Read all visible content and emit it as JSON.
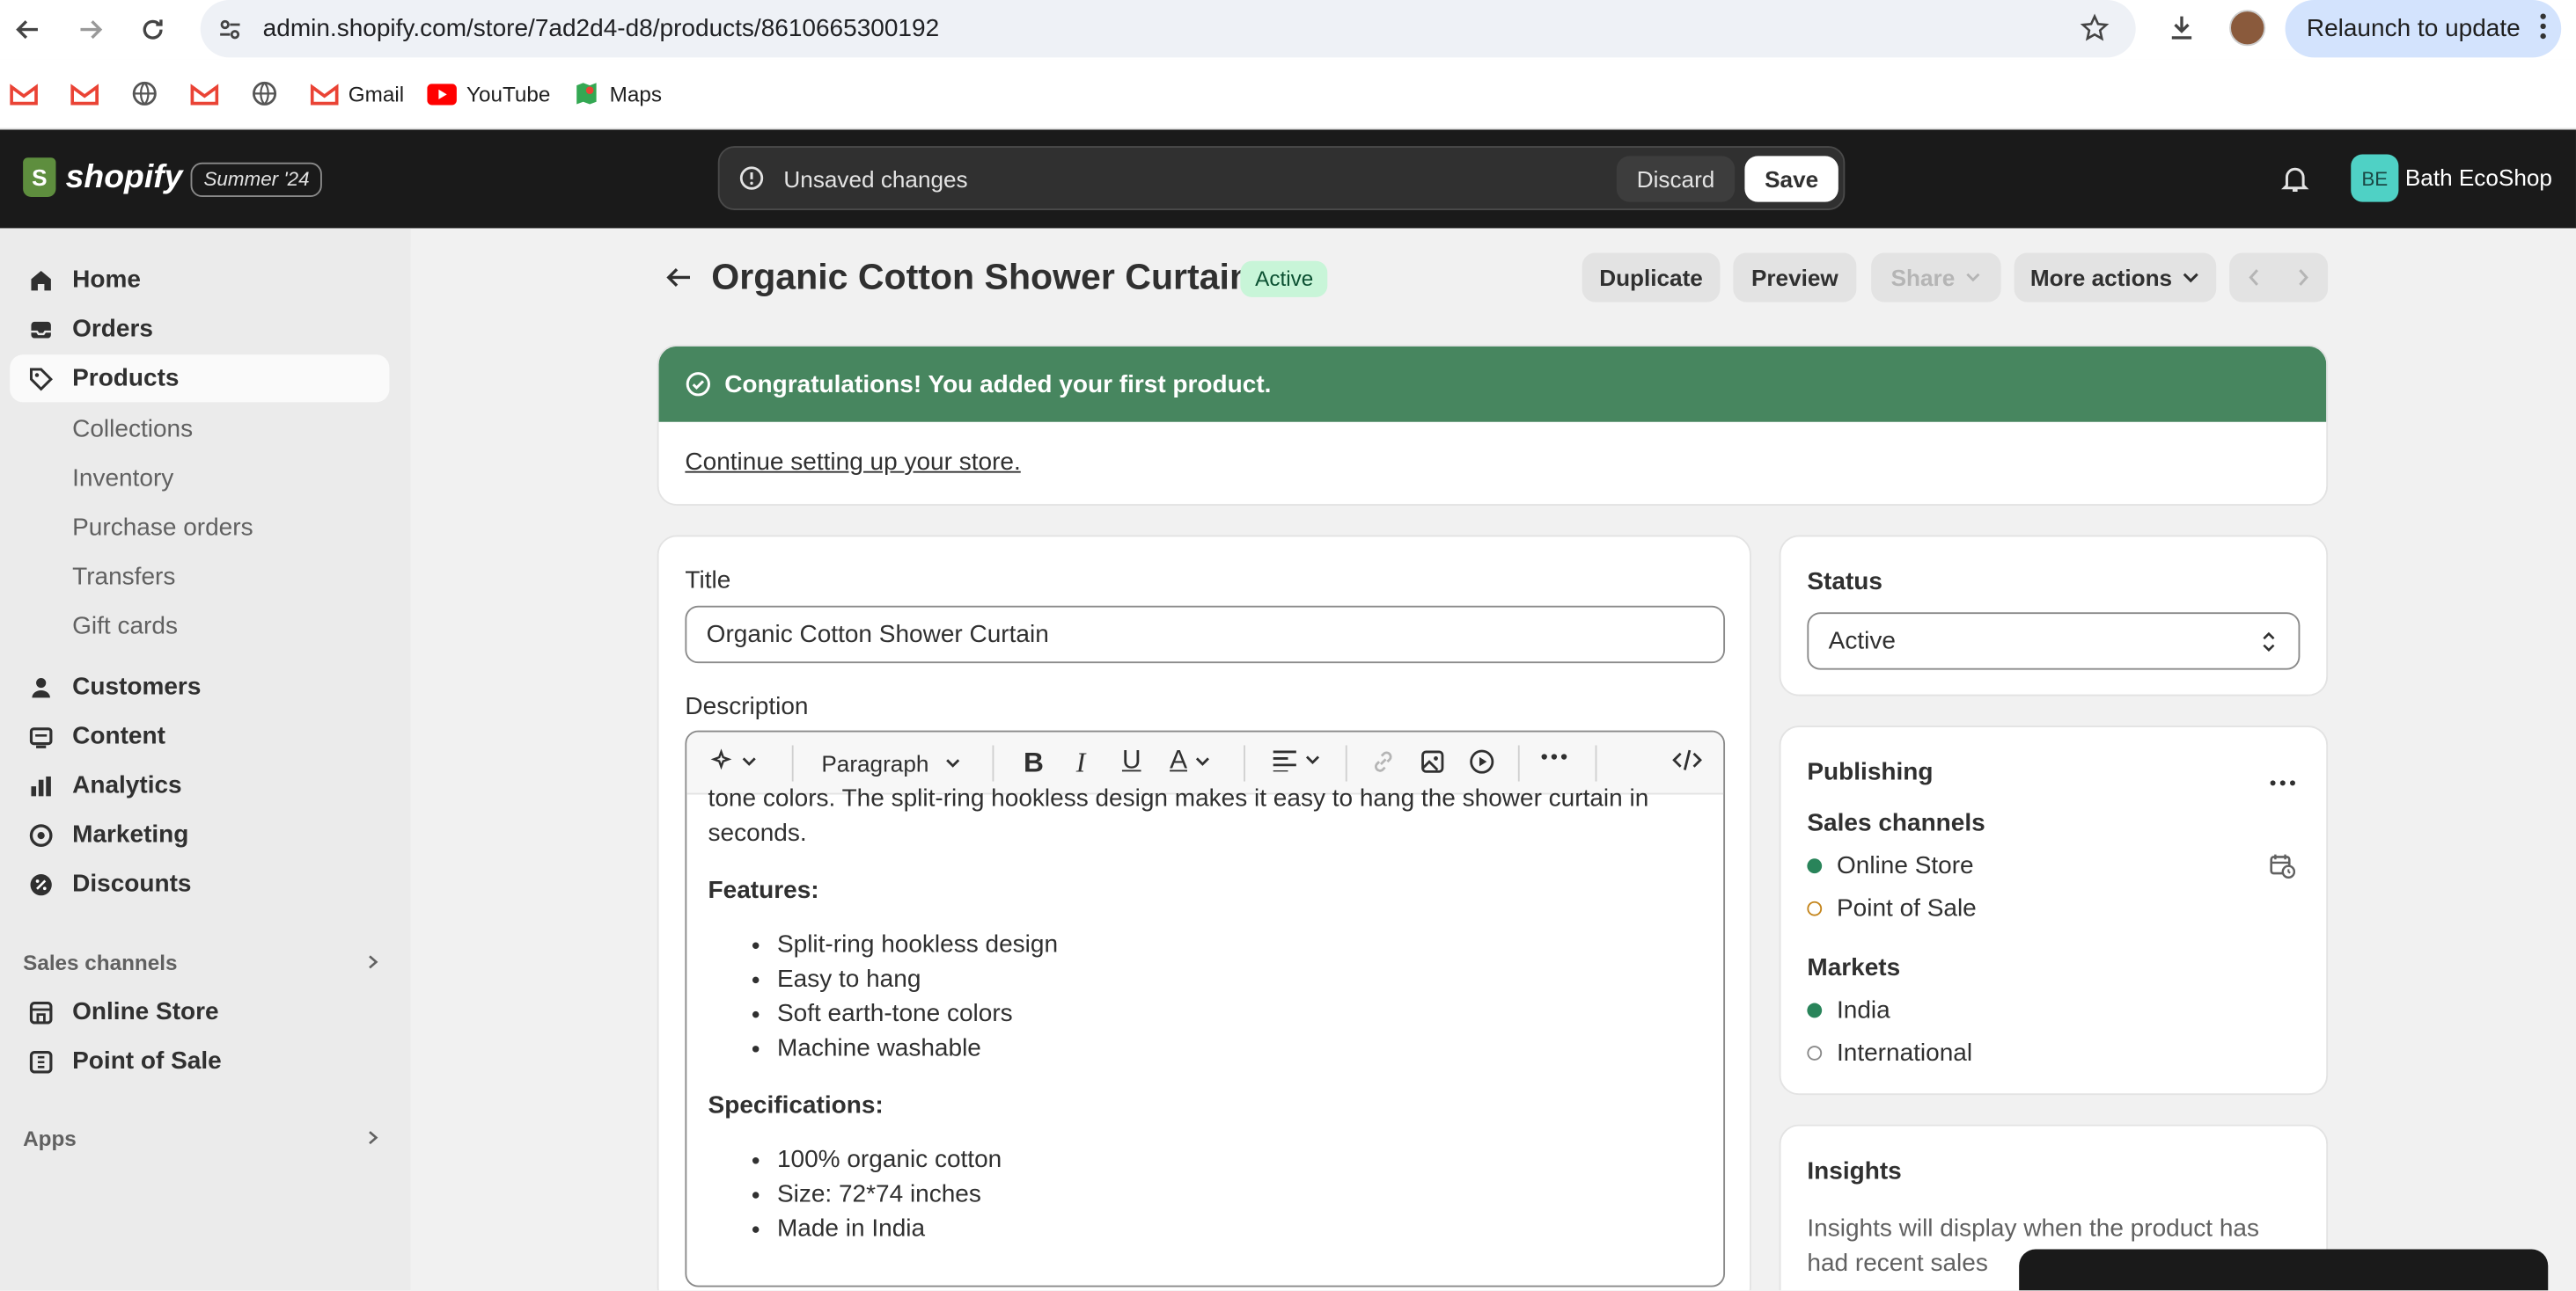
{
  "browser": {
    "url": "admin.shopify.com/store/7ad2d4-d8/products/8610665300192",
    "relaunch_label": "Relaunch to update",
    "bookmarks": [
      {
        "label": ""
      },
      {
        "label": ""
      },
      {
        "label": ""
      },
      {
        "label": ""
      },
      {
        "label": ""
      },
      {
        "label": "Gmail"
      },
      {
        "label": "YouTube"
      },
      {
        "label": "Maps"
      }
    ]
  },
  "topbar": {
    "brand": "shopify",
    "season_badge": "Summer '24",
    "unsaved_text": "Unsaved changes",
    "discard_label": "Discard",
    "save_label": "Save",
    "store_initials": "BE",
    "store_name": "Bath EcoShop"
  },
  "sidebar": {
    "items": [
      {
        "label": "Home"
      },
      {
        "label": "Orders"
      },
      {
        "label": "Products"
      },
      {
        "label": "Customers"
      },
      {
        "label": "Content"
      },
      {
        "label": "Analytics"
      },
      {
        "label": "Marketing"
      },
      {
        "label": "Discounts"
      }
    ],
    "product_subitems": [
      "Collections",
      "Inventory",
      "Purchase orders",
      "Transfers",
      "Gift cards"
    ],
    "sales_channels_heading": "Sales channels",
    "sales_channels": [
      "Online Store",
      "Point of Sale"
    ],
    "apps_heading": "Apps"
  },
  "page": {
    "title": "Organic Cotton Shower Curtain",
    "status_badge": "Active",
    "actions": {
      "duplicate": "Duplicate",
      "preview": "Preview",
      "share": "Share",
      "more": "More actions"
    }
  },
  "banner": {
    "title": "Congratulations! You added your first product.",
    "link": "Continue setting up your store."
  },
  "product_form": {
    "title_label": "Title",
    "title_value": "Organic Cotton Shower Curtain",
    "description_label": "Description",
    "toolbar_paragraph": "Paragraph",
    "description": {
      "intro_line1": "tone colors. The split-ring hookless design makes it easy to hang the shower curtain in",
      "intro_line2": "seconds.",
      "features_heading": "Features:",
      "features": [
        "Split-ring hookless design",
        "Easy to hang",
        "Soft earth-tone colors",
        "Machine washable"
      ],
      "specs_heading": "Specifications:",
      "specs": [
        "100% organic cotton",
        "Size: 72*74 inches",
        "Made in India"
      ]
    }
  },
  "status_card": {
    "heading": "Status",
    "value": "Active"
  },
  "publishing_card": {
    "heading": "Publishing",
    "sales_channels_label": "Sales channels",
    "channels": [
      "Online Store",
      "Point of Sale"
    ],
    "markets_label": "Markets",
    "markets": [
      "India",
      "International"
    ]
  },
  "insights_card": {
    "heading": "Insights",
    "text_line1": "Insights will display when the product has",
    "text_line2": "had recent sales"
  },
  "colors": {
    "brand_green": "#47865f",
    "topbar_bg": "#1a1a1a",
    "active_badge_bg": "#c8f5d8"
  }
}
